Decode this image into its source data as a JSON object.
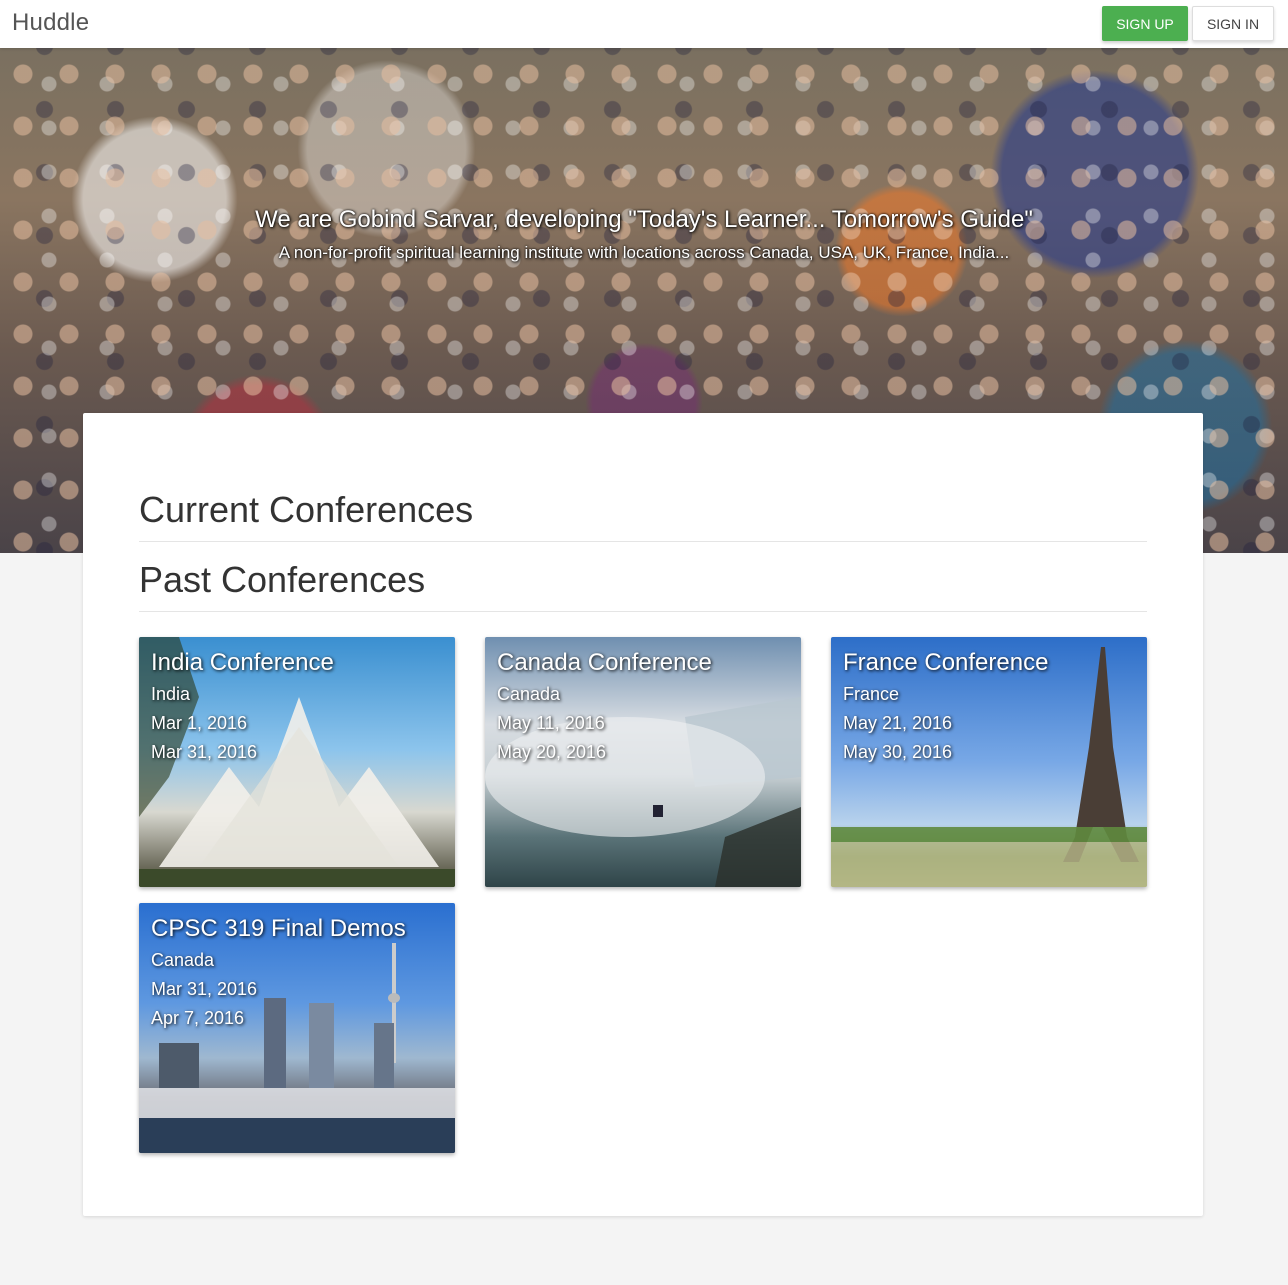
{
  "nav": {
    "brand": "Huddle",
    "signup_label": "SIGN UP",
    "signin_label": "SIGN IN"
  },
  "hero": {
    "title": "We are Gobind Sarvar, developing \"Today's Learner... Tomorrow's Guide\"",
    "subtitle": "A non-for-profit spiritual learning institute with locations across Canada, USA, UK, France, India..."
  },
  "sections": {
    "current": "Current Conferences",
    "past": "Past Conferences"
  },
  "past_conferences": [
    {
      "name": "India Conference",
      "country": "India",
      "start": "Mar 1, 2016",
      "end": "Mar 31, 2016"
    },
    {
      "name": "Canada Conference",
      "country": "Canada",
      "start": "May 11, 2016",
      "end": "May 20, 2016"
    },
    {
      "name": "France Conference",
      "country": "France",
      "start": "May 21, 2016",
      "end": "May 30, 2016"
    },
    {
      "name": "CPSC 319 Final Demos",
      "country": "Canada",
      "start": "Mar 31, 2016",
      "end": "Apr 7, 2016"
    }
  ],
  "colors": {
    "signup": "#4caf50",
    "page_bg": "#f4f4f4"
  }
}
